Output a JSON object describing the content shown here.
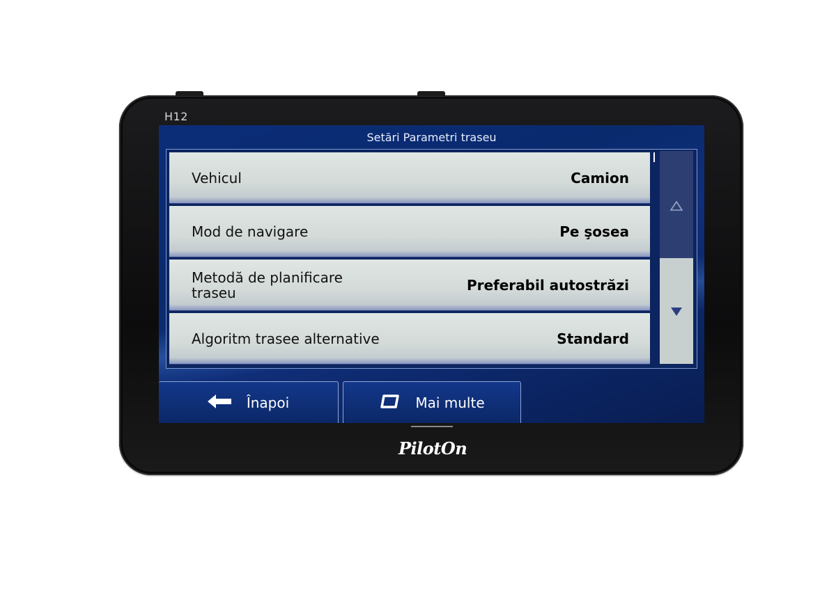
{
  "device": {
    "model": "H12",
    "brand": "PilotOn"
  },
  "screen": {
    "title": "Setări Parametri traseu",
    "settings": [
      {
        "label": "Vehicul",
        "value": "Camion"
      },
      {
        "label": "Mod de navigare",
        "value": "Pe şosea"
      },
      {
        "label": "Metodă de planificare traseu",
        "value": "Preferabil autostrăzi"
      },
      {
        "label": "Algoritm trasee alternative",
        "value": "Standard"
      }
    ],
    "scrollbar": {
      "up_icon": "triangle-up-icon",
      "down_icon": "triangle-down-icon",
      "position_fraction": 0.0
    },
    "buttons": {
      "back_label": "Înapoi",
      "back_icon": "arrow-left-icon",
      "more_label": "Mai multe",
      "more_icon": "rounded-square-icon"
    }
  },
  "colors": {
    "screen_bg": "#0a2a6e",
    "row_bg": "#d9e0de",
    "scroll_thumb": "#2d3f72"
  }
}
